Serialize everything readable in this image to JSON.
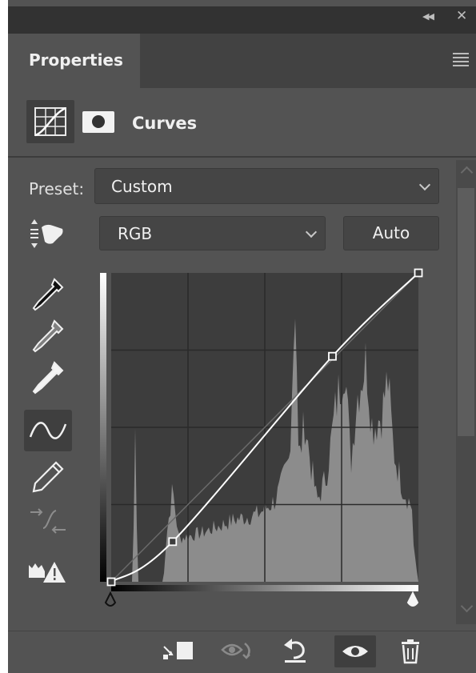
{
  "window": {
    "collapse_icon": "double-chevron-left-icon",
    "close_icon": "close-icon"
  },
  "panel": {
    "tab_label": "Properties",
    "menu_icon": "hamburger-menu-icon"
  },
  "header": {
    "adjustment_icon": "curves-grid-icon",
    "mask_icon": "layer-mask-icon",
    "title": "Curves"
  },
  "preset": {
    "label": "Preset:",
    "value": "Custom"
  },
  "channel": {
    "value": "RGB",
    "auto_label": "Auto"
  },
  "tools": [
    {
      "name": "on-image-adjust-icon"
    },
    {
      "name": "black-point-eyedropper-icon"
    },
    {
      "name": "gray-point-eyedropper-icon"
    },
    {
      "name": "white-point-eyedropper-icon"
    },
    {
      "name": "edit-points-curve-icon",
      "active": true
    },
    {
      "name": "pencil-draw-icon"
    },
    {
      "name": "smooth-curve-icon",
      "disabled": true
    },
    {
      "name": "clipping-warning-icon"
    }
  ],
  "curve": {
    "points": [
      [
        0,
        0
      ],
      [
        20,
        13
      ],
      [
        72,
        73
      ],
      [
        100,
        100
      ]
    ],
    "grid_divisions": 4
  },
  "footer": {
    "clip_to_layer_icon": "clip-to-layer-icon",
    "view_previous_icon": "view-previous-state-icon",
    "reset_icon": "reset-icon",
    "visibility_icon": "visibility-eye-icon",
    "delete_icon": "trash-icon"
  },
  "colors": {
    "panel_bg": "#535353",
    "titlebar_bg": "#323232",
    "graph_bg": "#3d3d3d",
    "histogram": "#8c8c8c",
    "curve": "#ffffff"
  }
}
